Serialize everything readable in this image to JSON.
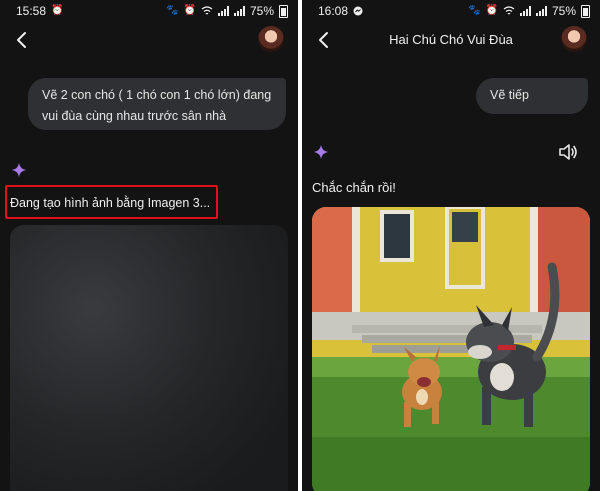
{
  "left": {
    "status": {
      "time": "15:58",
      "battery": "75%"
    },
    "user_message": "Vẽ 2 con chó ( 1 chó con 1 chó lớn) đang vui đùa cùng nhau trước sân nhà",
    "generating_text": "Đang tạo hình ảnh bằng Imagen 3..."
  },
  "right": {
    "status": {
      "time": "16:08",
      "battery": "75%"
    },
    "title": "Hai Chú Chó Vui Đùa",
    "user_message": "Vẽ tiếp",
    "reply": "Chắc chắn rồi!"
  },
  "colors": {
    "background": "#131314",
    "bubble": "#2f3033",
    "accent": "#a77ae8",
    "highlight": "#e3101c"
  },
  "icons": [
    "back-arrow-icon",
    "sparkle-icon",
    "speaker-icon",
    "alarm-icon",
    "paw-icon",
    "wifi-icon",
    "signal-icon",
    "battery-icon",
    "messenger-icon"
  ]
}
